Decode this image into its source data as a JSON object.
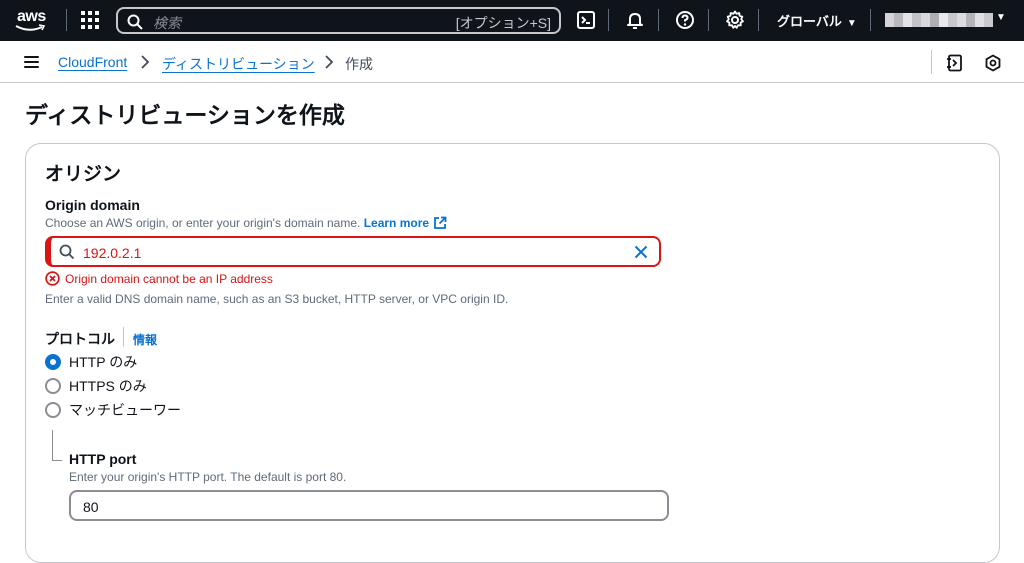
{
  "topnav": {
    "logo_text": "aws",
    "search_placeholder": "検索",
    "search_shortcut": "[オプション+S]",
    "region_label": "グローバル",
    "account_mosaic": [
      "#d5d5d9",
      "#b8b8bd",
      "#e4e4e7",
      "#c2c2c7",
      "#d9d9dd",
      "#aeaeb3",
      "#e8e8eb",
      "#c8c8cc",
      "#dcdce0",
      "#b3b3b8",
      "#e0e0e3",
      "#cacace"
    ]
  },
  "breadcrumb": {
    "items": [
      "CloudFront",
      "ディストリビューション",
      "作成"
    ]
  },
  "page": {
    "title": "ディストリビューションを作成"
  },
  "origin_section": {
    "title": "オリジン",
    "origin_domain": {
      "label": "Origin domain",
      "description": "Choose an AWS origin, or enter your origin's domain name.",
      "learn_more": "Learn more",
      "value": "192.0.2.1",
      "error": "Origin domain cannot be an IP address",
      "hint": "Enter a valid DNS domain name, such as an S3 bucket, HTTP server, or VPC origin ID."
    },
    "protocol": {
      "label": "プロトコル",
      "info": "情報",
      "options": [
        "HTTP のみ",
        "HTTPS のみ",
        "マッチビューワー"
      ],
      "selected_index": 0
    },
    "http_port": {
      "label": "HTTP port",
      "description": "Enter your origin's HTTP port. The default is port 80.",
      "value": "80"
    }
  },
  "colors": {
    "nav_bg": "#0f141a",
    "link": "#0972d3",
    "error": "#d91515",
    "border": "#c6c6cd"
  }
}
